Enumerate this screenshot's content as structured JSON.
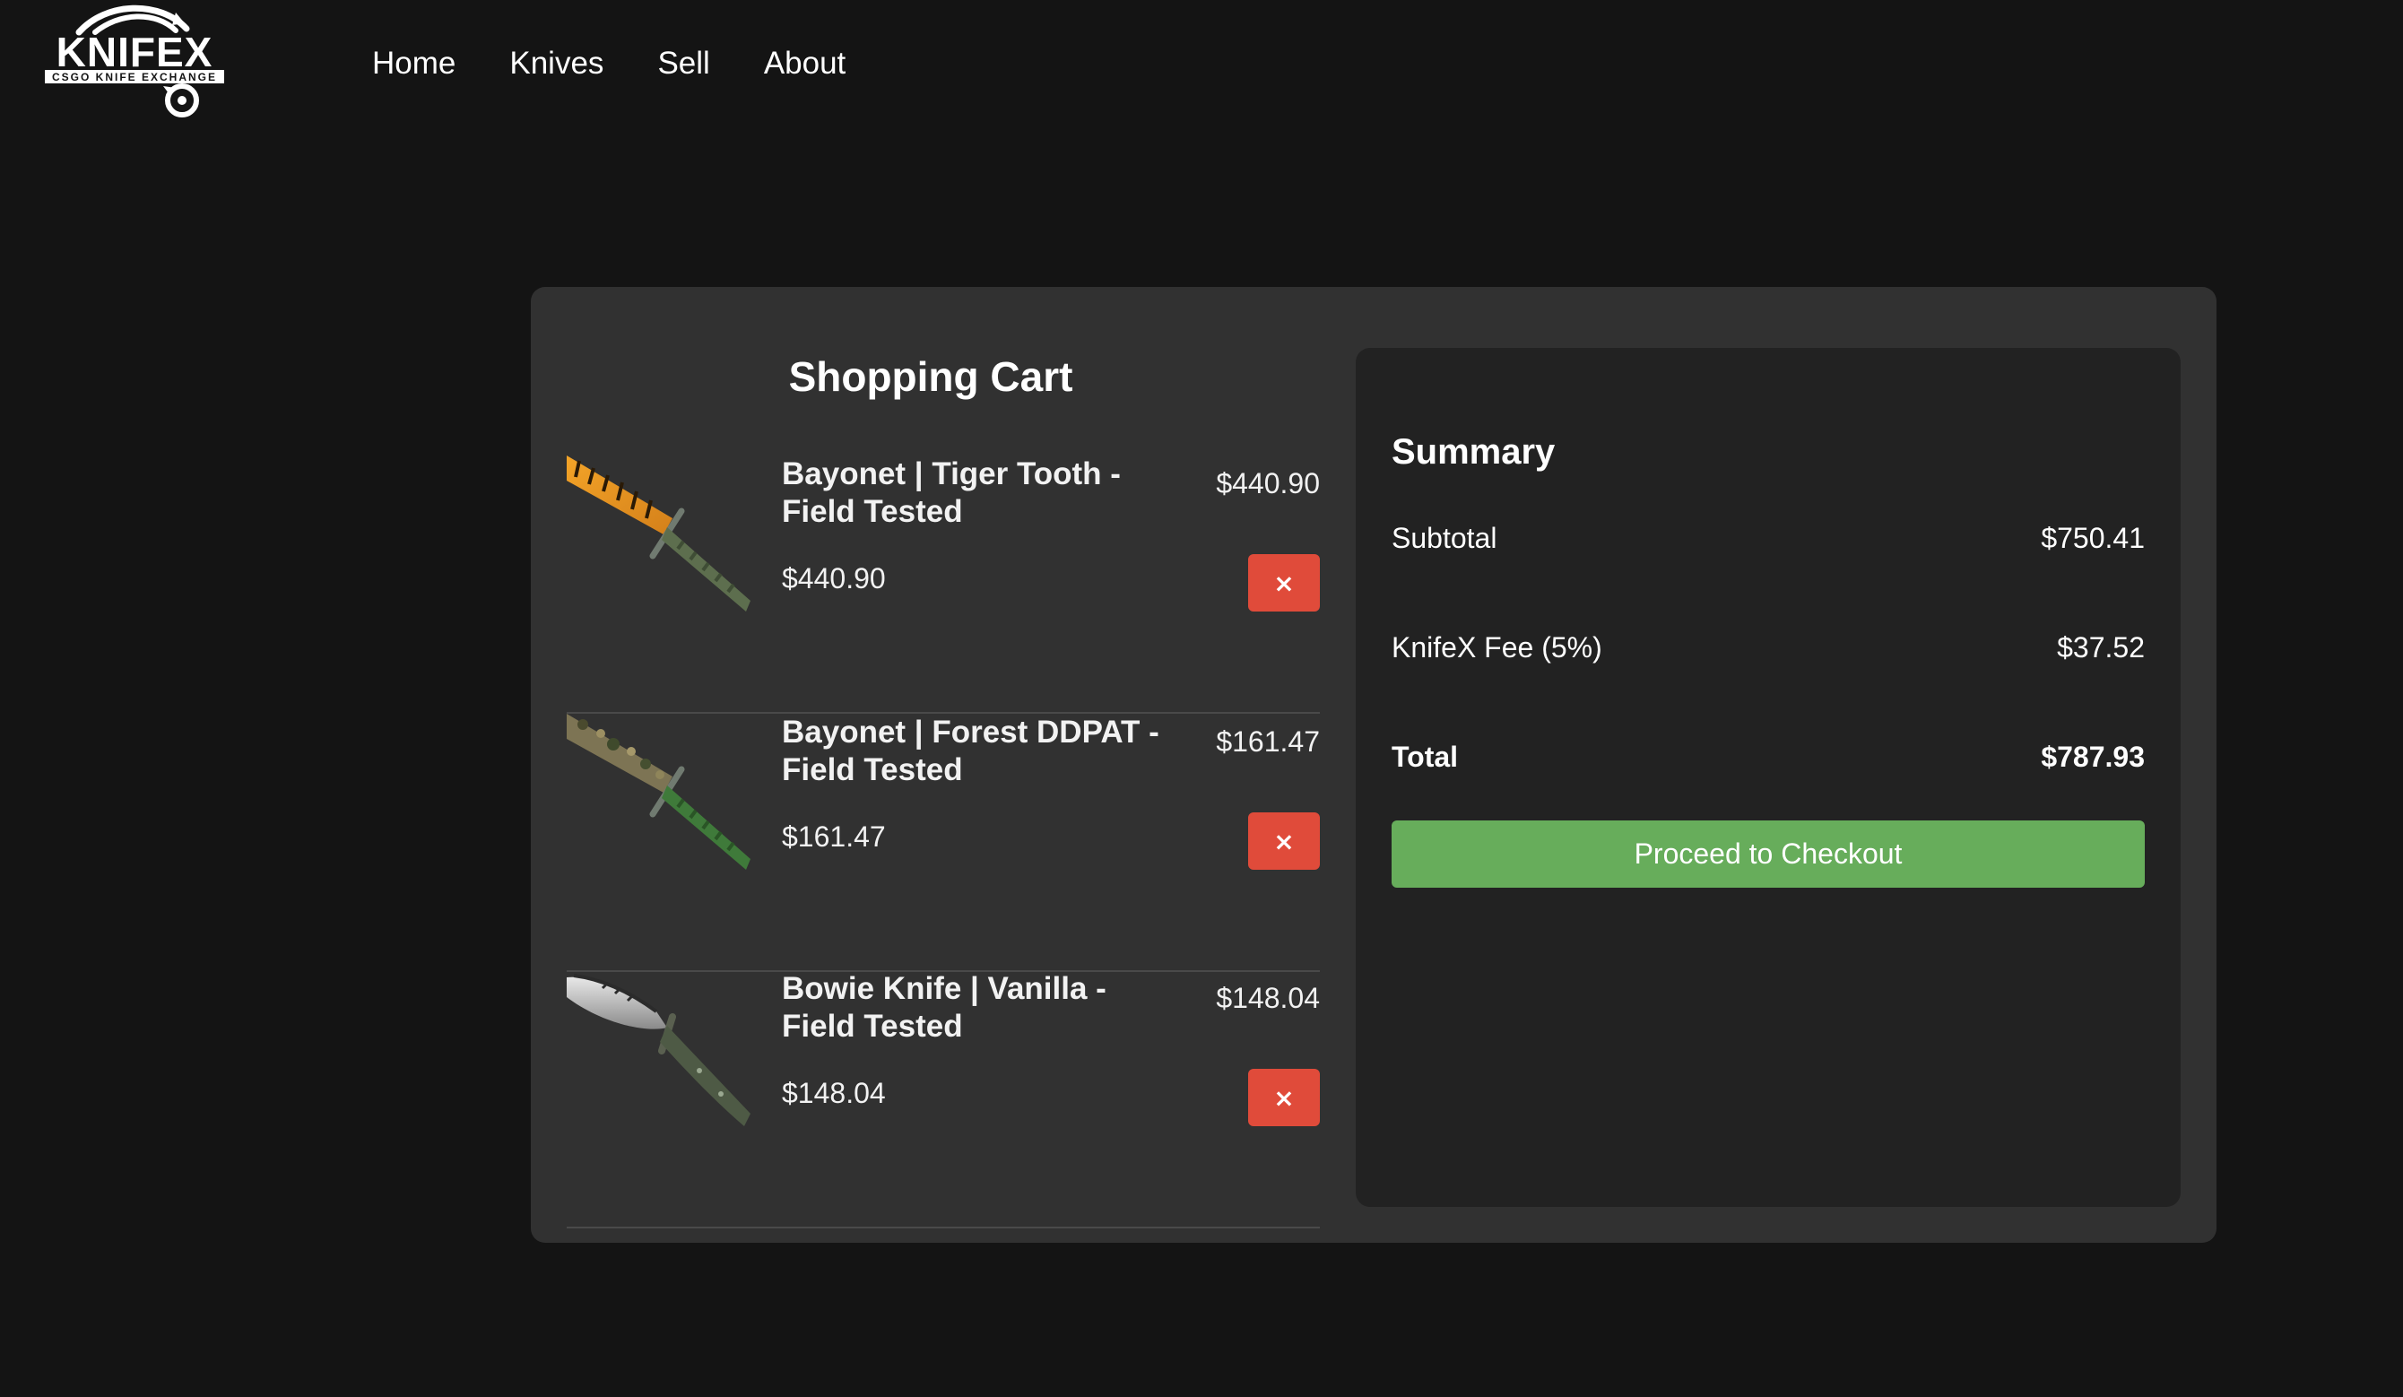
{
  "brand": {
    "name": "KNIFEX",
    "tagline": "CSGO KNIFE EXCHANGE"
  },
  "nav": {
    "items": [
      {
        "label": "Home"
      },
      {
        "label": "Knives"
      },
      {
        "label": "Sell"
      },
      {
        "label": "About"
      }
    ]
  },
  "cart": {
    "title": "Shopping Cart",
    "remove_label": "×",
    "items": [
      {
        "name": "Bayonet | Tiger Tooth - Field Tested",
        "price": "$440.90",
        "image": "bayonet-tiger-tooth"
      },
      {
        "name": "Bayonet | Forest DDPAT - Field Tested",
        "price": "$161.47",
        "image": "bayonet-forest-ddpat"
      },
      {
        "name": "Bowie Knife | Vanilla - Field Tested",
        "price": "$148.04",
        "image": "bowie-knife-vanilla"
      }
    ]
  },
  "summary": {
    "title": "Summary",
    "subtotal_label": "Subtotal",
    "subtotal_value": "$750.41",
    "fee_label": "KnifeX Fee (5%)",
    "fee_value": "$37.52",
    "total_label": "Total",
    "total_value": "$787.93",
    "checkout_label": "Proceed to Checkout"
  },
  "colors": {
    "background": "#141414",
    "panel": "#313131",
    "summary_panel": "#222222",
    "remove_button": "#e04b3a",
    "checkout_button": "#67ad5b"
  }
}
